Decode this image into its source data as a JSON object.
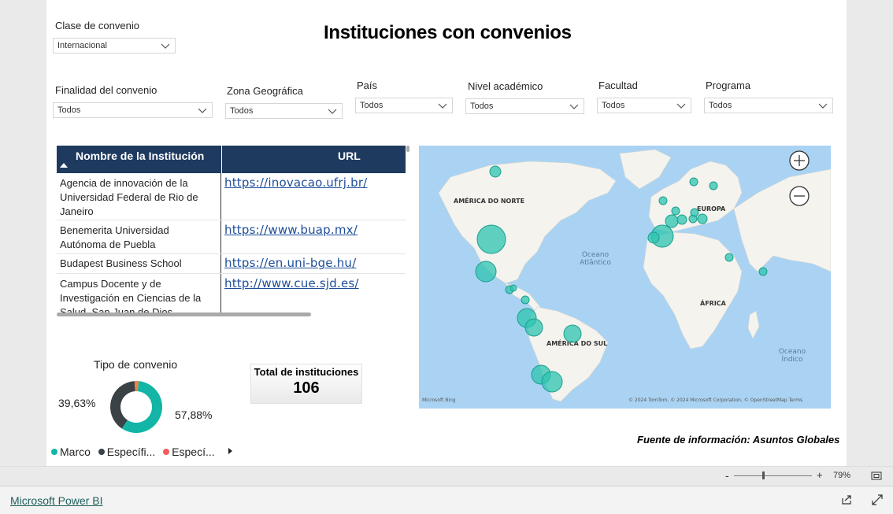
{
  "report": {
    "title": "Instituciones con convenios",
    "source_note": "Fuente de información: Asuntos Globales"
  },
  "slicers": {
    "clase": {
      "label": "Clase de convenio",
      "value": "Internacional"
    },
    "finalidad": {
      "label": "Finalidad del convenio",
      "value": "Todos"
    },
    "zona": {
      "label": "Zona Geográfica",
      "value": "Todos"
    },
    "pais": {
      "label": "País",
      "value": "Todos"
    },
    "nivel": {
      "label": "Nivel académico",
      "value": "Todos"
    },
    "facultad": {
      "label": "Facultad",
      "value": "Todos"
    },
    "programa": {
      "label": "Programa",
      "value": "Todos"
    }
  },
  "table": {
    "headers": [
      "Nombre de la Institución",
      "URL"
    ],
    "rows": [
      {
        "name": "Agencia de innovación de la Universidad Federal de Rio de Janeiro",
        "url": "https://inovacao.ufrj.br/"
      },
      {
        "name": "Benemerita Universidad Autónoma de Puebla",
        "url": "https://www.buap.mx/"
      },
      {
        "name": "Budapest Business School",
        "url": "https://en.uni-bge.hu/"
      },
      {
        "name": "Campus Docente y de Investigación en Ciencias de la Salud, San Juan de Dios",
        "url": "http://www.cue.sjd.es/"
      }
    ]
  },
  "donut": {
    "title": "Tipo de convenio",
    "label_left": "39,63%",
    "label_right": "57,88%",
    "slices": [
      {
        "name": "Marco",
        "value": 57.88,
        "color": "#12b5a6"
      },
      {
        "name": "Específi...",
        "value": 39.63,
        "color": "#3b4246"
      },
      {
        "name": "Especí...",
        "value": 2.49,
        "color": "#f0813e"
      }
    ],
    "legend_colors": [
      "#12b5a6",
      "#3b4246",
      "#f25c5c"
    ]
  },
  "card": {
    "title": "Total de instituciones",
    "value": "106"
  },
  "map": {
    "labels": {
      "na": "AMÉRICA DO NORTE",
      "eu": "EUROPA",
      "ocean": "Oceano",
      "ocean2": "Atlântico",
      "af": "ÁFRICA",
      "sa": "AMÉRICA DO SUL",
      "io": "Oceano",
      "io2": "Índico"
    },
    "attribution": "© 2024 TomTom, © 2024 Microsoft Corporation, © OpenStreetMap  Terms",
    "brand": "Microsoft Bing",
    "bubble_color": "#2ec4b0"
  },
  "footer": {
    "zoom": "79%",
    "minus": "-",
    "plus": "+",
    "powerbi": "Microsoft Power BI"
  }
}
